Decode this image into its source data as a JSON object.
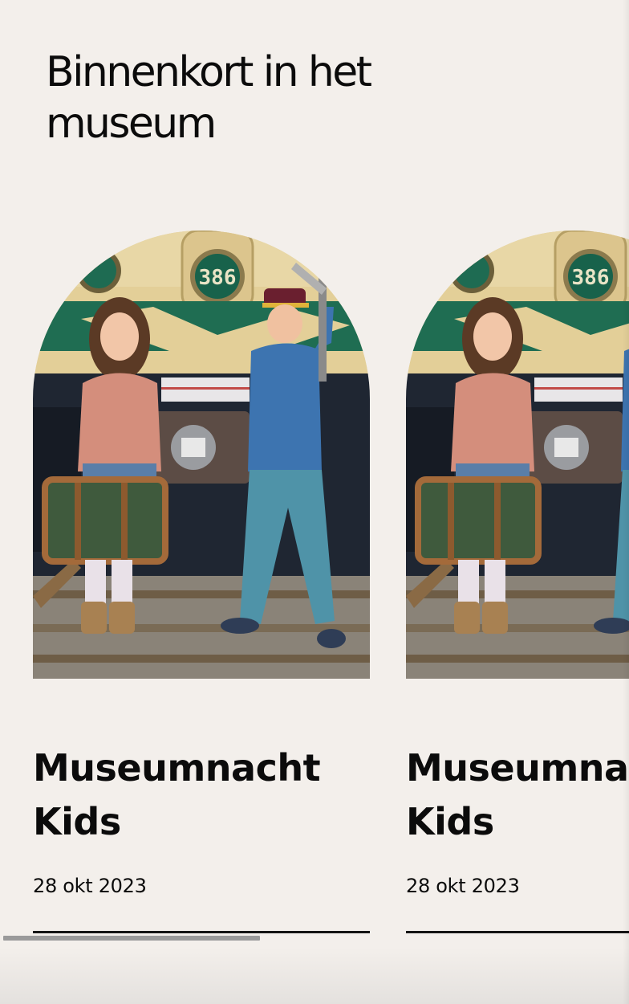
{
  "section": {
    "title": "Binnenkort in het museum"
  },
  "events": [
    {
      "title": "Museumnacht\nKids",
      "date": "28 okt 2023",
      "image": "kids-at-train-photo"
    },
    {
      "title": "Museumnacht\nKids",
      "date": "28 okt 2023",
      "image": "kids-at-train-photo"
    }
  ],
  "scrollbar": {
    "position": 0.41
  },
  "colors": {
    "background": "#f3efeb",
    "text": "#0b0b0b",
    "scroll_thumb": "#9a9a9a"
  }
}
